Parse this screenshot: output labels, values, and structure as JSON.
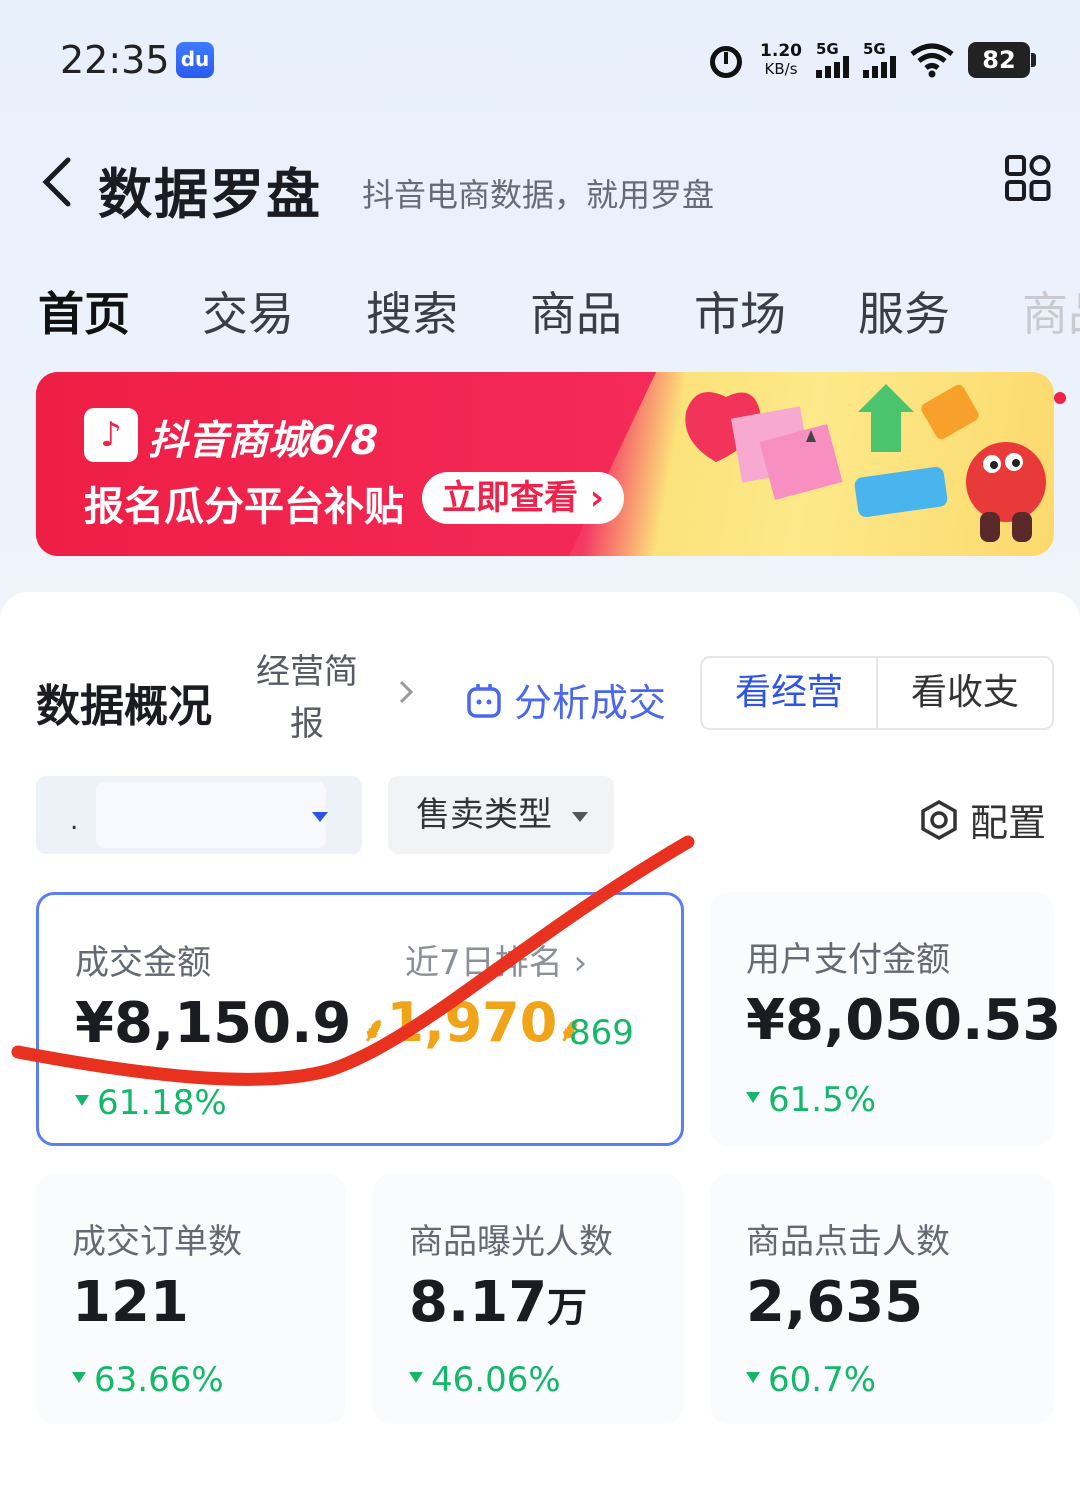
{
  "status_bar": {
    "time": "22:35",
    "app_icon": "du",
    "speed_value": "1.20",
    "speed_unit": "KB/s",
    "signal1_label": "5G",
    "signal2_label": "5G",
    "battery": "82",
    "icons": [
      "alarm-icon",
      "signal-icon",
      "wifi-icon",
      "battery-icon"
    ]
  },
  "header": {
    "title": "数据罗盘",
    "subtitle": "抖音电商数据，就用罗盘",
    "back_icon": "chevron-left-icon",
    "menu_icon": "grid-icon"
  },
  "tabs": [
    {
      "label": "首页",
      "active": true
    },
    {
      "label": "交易"
    },
    {
      "label": "搜索"
    },
    {
      "label": "商品"
    },
    {
      "label": "市场"
    },
    {
      "label": "服务"
    },
    {
      "label": "商品"
    }
  ],
  "banner": {
    "title": "抖音商城6/8",
    "subtitle": "报名瓜分平台补贴",
    "button": "立即查看 ›",
    "bg_colors": [
      "#f0224a",
      "#fbe27a"
    ]
  },
  "overview": {
    "title": "数据概况",
    "brief": "经营简报",
    "analyze": "分析成交",
    "segment": [
      "看经营",
      "看收支"
    ],
    "filter_type": "售卖类型",
    "config": "配置"
  },
  "metrics": {
    "gmv": {
      "label": "成交金额",
      "value": "¥8,150.9",
      "delta": "61.18%",
      "rank_label": "近7日排名",
      "rank_value": "1,970",
      "rank_delta": "869"
    },
    "user_pay": {
      "label": "用户支付金额",
      "value": "¥8,050.53",
      "delta": "61.5%"
    },
    "orders": {
      "label": "成交订单数",
      "value": "121",
      "delta": "63.66%"
    },
    "exposure": {
      "label": "商品曝光人数",
      "value_num": "8.17",
      "value_unit": "万",
      "delta": "46.06%"
    },
    "clicks": {
      "label": "商品点击人数",
      "value": "2,635",
      "delta": "60.7%"
    }
  },
  "colors": {
    "accent": "#2d54e6",
    "down": "#14b86b",
    "rank": "#f0a41a",
    "brand": "#f0224a"
  }
}
